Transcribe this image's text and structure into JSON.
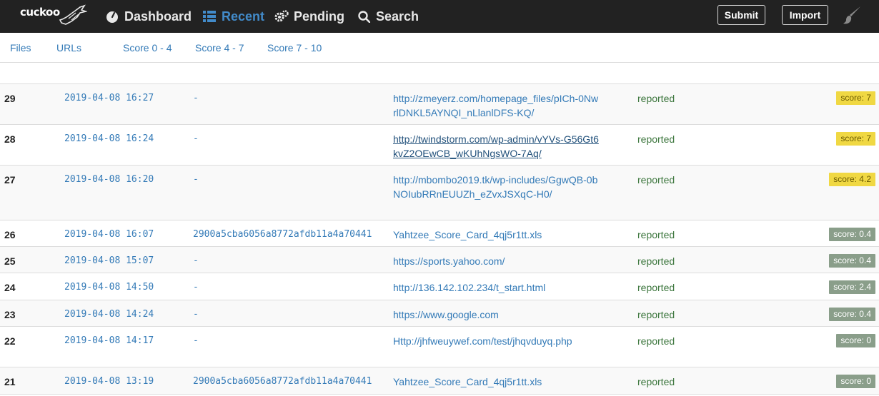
{
  "brand": {
    "name": "cuckoo",
    "logo_icon": "cuckoo-bird-icon"
  },
  "nav": {
    "dashboard": "Dashboard",
    "recent": "Recent",
    "pending": "Pending",
    "search": "Search"
  },
  "actions": {
    "submit": "Submit",
    "import": "Import",
    "theme_icon": "paint-brush-icon"
  },
  "filters": {
    "files": "Files",
    "urls": "URLs",
    "score_0_4": "Score 0 - 4",
    "score_4_7": "Score 4 - 7",
    "score_7_10": "Score 7 - 10"
  },
  "colors": {
    "accent": "#428bca",
    "navbar": "#222222",
    "warn_badge": "#f0d843",
    "low_badge": "#8a9e8a",
    "status": "#3c763d"
  },
  "rows": [
    {
      "id": "29",
      "date": "2019-04-08 16:27",
      "md5": "-",
      "target": "http://zmeyerz.com/homepage_files/pICh-0NwrlDNKL5AYNQI_nLlanlDFS-KQ/",
      "status": "reported",
      "score": "score: 7"
    },
    {
      "id": "28",
      "date": "2019-04-08 16:24",
      "md5": "-",
      "target": "http://twindstorm.com/wp-admin/vYVs-G56Gt6kvZ2OEwCB_wKUhNgsWO-7Aq/",
      "status": "reported",
      "score": "score: 7"
    },
    {
      "id": "27",
      "date": "2019-04-08 16:20",
      "md5": "-",
      "target": "http://mbombo2019.tk/wp-includes/GgwQB-0bNOIubRRnEUUZh_eZvxJSXqC-H0/",
      "status": "reported",
      "score": "score: 4.2"
    },
    {
      "id": "26",
      "date": "2019-04-08 16:07",
      "md5": "2900a5cba6056a8772afdb11a4a70441",
      "target": "Yahtzee_Score_Card_4qj5r1tt.xls",
      "status": "reported",
      "score": "score: 0.4"
    },
    {
      "id": "25",
      "date": "2019-04-08 15:07",
      "md5": "-",
      "target": "https://sports.yahoo.com/",
      "status": "reported",
      "score": "score: 0.4"
    },
    {
      "id": "24",
      "date": "2019-04-08 14:50",
      "md5": "-",
      "target": "http://136.142.102.234/t_start.html",
      "status": "reported",
      "score": "score: 2.4"
    },
    {
      "id": "23",
      "date": "2019-04-08 14:24",
      "md5": "-",
      "target": "https://www.google.com",
      "status": "reported",
      "score": "score: 0.4"
    },
    {
      "id": "22",
      "date": "2019-04-08 14:17",
      "md5": "-",
      "target": "Http://jhfweuywef.com/test/jhqvduyq.php",
      "status": "reported",
      "score": "score: 0"
    },
    {
      "id": "21",
      "date": "2019-04-08 13:19",
      "md5": "2900a5cba6056a8772afdb11a4a70441",
      "target": "Yahtzee_Score_Card_4qj5r1tt.xls",
      "status": "reported",
      "score": "score: 0"
    }
  ]
}
